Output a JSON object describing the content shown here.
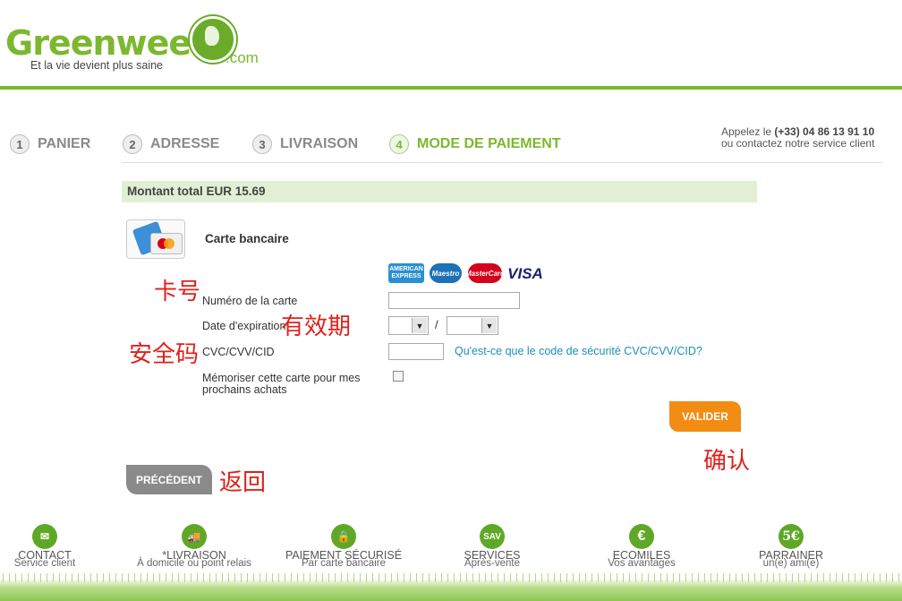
{
  "header": {
    "logo_text": "Greenwee",
    "logo_suffix": ".com",
    "tagline": "Et la vie devient plus saine"
  },
  "steps": [
    {
      "num": "1",
      "label": "PANIER"
    },
    {
      "num": "2",
      "label": "ADRESSE"
    },
    {
      "num": "3",
      "label": "LIVRAISON"
    },
    {
      "num": "4",
      "label": "MODE DE PAIEMENT"
    }
  ],
  "contact": {
    "line1_prefix": "Appelez le ",
    "phone": "(+33) 04 86 13 91 10",
    "line2": "ou contactez notre service client"
  },
  "payment": {
    "total": "Montant total EUR 15.69",
    "method_title": "Carte bancaire",
    "brands": {
      "amex": "AMERICAN EXPRESS",
      "maestro": "Maestro",
      "mastercard": "MasterCard",
      "visa": "VISA"
    },
    "card_number_label": "Numéro de la carte",
    "expiry_label": "Date d'expiration",
    "expiry_separator": "/",
    "cvc_label": "CVC/CVV/CID",
    "cvc_help_link": "Qu'est-ce que le code de sécurité CVC/CVV/CID?",
    "remember_label_1": "Mémoriser cette carte pour mes",
    "remember_label_2": "prochains achats",
    "card_number_value": "",
    "cvc_value": "",
    "remember_checked": false,
    "submit_label": "VALIDER",
    "back_label": "PRÉCÉDENT"
  },
  "annotations": {
    "card_number": "卡号",
    "expiry": "有效期",
    "cvc": "安全码",
    "confirm": "确认",
    "back": "返回"
  },
  "footer": [
    {
      "icon": "envelope-icon",
      "glyph": "✉",
      "title": "CONTACT",
      "subtitle": "Service client"
    },
    {
      "icon": "truck-icon",
      "glyph": "🚚",
      "title": "*LIVRAISON",
      "subtitle": "À domicile ou point relais"
    },
    {
      "icon": "lock-icon",
      "glyph": "🔒",
      "title": "PAIEMENT SÉCURISÉ",
      "subtitle": "Par carte bancaire"
    },
    {
      "icon": "sav-icon",
      "glyph": "SAV",
      "title": "SERVICES",
      "subtitle": "Après-vente"
    },
    {
      "icon": "euro-icon",
      "glyph": "€",
      "title": "ECOMILES",
      "subtitle": "Vos avantages"
    },
    {
      "icon": "five-euro-icon",
      "glyph": "5€",
      "title": "PARRAINER",
      "subtitle": "un(e) ami(e)"
    }
  ],
  "colors": {
    "brand_green": "#7cb82f",
    "valider_orange": "#f28c13",
    "annotation_red": "#e0201a"
  }
}
